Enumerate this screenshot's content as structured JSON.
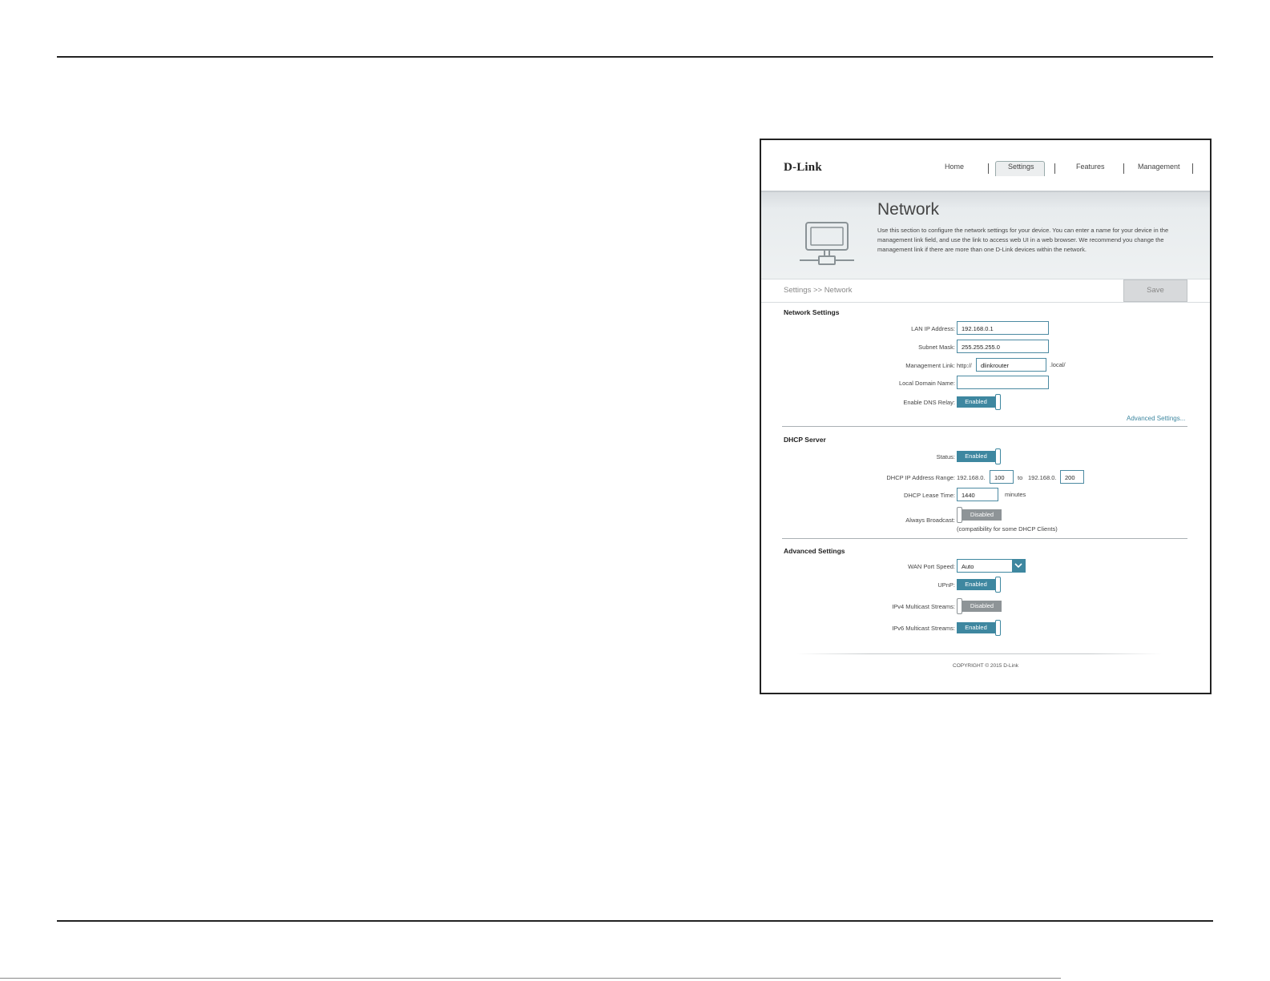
{
  "app": {
    "logo": "D-Link",
    "nav": [
      "Home",
      "Settings",
      "Features",
      "Management"
    ],
    "active_nav": "Settings"
  },
  "hero": {
    "title": "Network",
    "description": "Use this section to configure the network settings for your device. You can enter a name for your device in the management link field, and use the link to access web UI in a web browser. We recommend you change the management link if there are more than one D-Link devices within the network."
  },
  "breadcrumb": "Settings >> Network",
  "save_label": "Save",
  "network_settings": {
    "title": "Network Settings",
    "lan_ip_label": "LAN IP Address:",
    "lan_ip_value": "192.168.0.1",
    "subnet_label": "Subnet Mask:",
    "subnet_value": "255.255.255.0",
    "mgmt_label": "Management Link:",
    "mgmt_prefix": "http://",
    "mgmt_value": "dlinkrouter",
    "mgmt_suffix": ".local/",
    "domain_label": "Local Domain Name:",
    "domain_value": "",
    "dns_relay_label": "Enable DNS Relay:",
    "dns_relay_state": "Enabled",
    "advanced_link": "Advanced Settings..."
  },
  "dhcp_server": {
    "title": "DHCP Server",
    "status_label": "Status:",
    "status_state": "Enabled",
    "range_label": "DHCP IP Address Range:",
    "range_prefix_start": "192.168.0.",
    "range_start": "100",
    "range_to": "to",
    "range_prefix_end": "192.168.0.",
    "range_end": "200",
    "lease_label": "DHCP Lease Time:",
    "lease_value": "1440",
    "lease_unit": "minutes",
    "broadcast_label": "Always Broadcast:",
    "broadcast_state": "Disabled",
    "broadcast_note": "(compatibility for some DHCP Clients)"
  },
  "advanced_settings": {
    "title": "Advanced Settings",
    "wan_speed_label": "WAN Port Speed:",
    "wan_speed_value": "Auto",
    "upnp_label": "UPnP:",
    "upnp_state": "Enabled",
    "ipv4_mc_label": "IPv4 Multicast Streams:",
    "ipv4_mc_state": "Disabled",
    "ipv6_mc_label": "IPv6 Multicast Streams:",
    "ipv6_mc_state": "Enabled"
  },
  "copyright": "COPYRIGHT © 2015 D-Link",
  "colors": {
    "accent": "#3e87a0",
    "disabled": "#8e9497"
  }
}
